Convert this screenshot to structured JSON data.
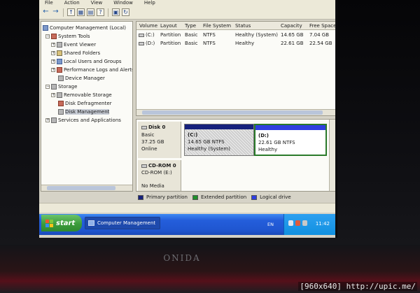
{
  "menu": [
    "File",
    "Action",
    "View",
    "Window",
    "Help"
  ],
  "toolbar": {
    "icons": [
      "back-arrow-icon",
      "forward-arrow-icon",
      "up-icon",
      "console-tree-icon",
      "properties-icon",
      "help-icon",
      "export-icon",
      "refresh-icon"
    ]
  },
  "tree": {
    "items": [
      {
        "label": "Computer Management (Local)",
        "indent": 0,
        "expander": "",
        "icon": "computer-icon"
      },
      {
        "label": "System Tools",
        "indent": 1,
        "expander": "−",
        "icon": "tools-icon"
      },
      {
        "label": "Event Viewer",
        "indent": 2,
        "expander": "+",
        "icon": "event-viewer-icon"
      },
      {
        "label": "Shared Folders",
        "indent": 2,
        "expander": "+",
        "icon": "shared-folder-icon"
      },
      {
        "label": "Local Users and Groups",
        "indent": 2,
        "expander": "+",
        "icon": "users-icon"
      },
      {
        "label": "Performance Logs and Alerts",
        "indent": 2,
        "expander": "+",
        "icon": "performance-icon"
      },
      {
        "label": "Device Manager",
        "indent": 2,
        "expander": "",
        "icon": "device-manager-icon"
      },
      {
        "label": "Storage",
        "indent": 1,
        "expander": "−",
        "icon": "storage-icon"
      },
      {
        "label": "Removable Storage",
        "indent": 2,
        "expander": "+",
        "icon": "removable-storage-icon"
      },
      {
        "label": "Disk Defragmenter",
        "indent": 2,
        "expander": "",
        "icon": "defragmenter-icon"
      },
      {
        "label": "Disk Management",
        "indent": 2,
        "expander": "",
        "icon": "disk-management-icon",
        "selected": true
      },
      {
        "label": "Services and Applications",
        "indent": 1,
        "expander": "+",
        "icon": "services-icon"
      }
    ]
  },
  "volumes": {
    "headers": [
      "Volume",
      "Layout",
      "Type",
      "File System",
      "Status",
      "Capacity",
      "Free Space"
    ],
    "rows": [
      {
        "volume": "(C:)",
        "layout": "Partition",
        "type": "Basic",
        "fs": "NTFS",
        "status": "Healthy (System)",
        "capacity": "14.65 GB",
        "free": "7.04 GB",
        "selected": true
      },
      {
        "volume": "(D:)",
        "layout": "Partition",
        "type": "Basic",
        "fs": "NTFS",
        "status": "Healthy",
        "capacity": "22.61 GB",
        "free": "22.54 GB"
      }
    ]
  },
  "disks": {
    "disk0": {
      "name": "Disk 0",
      "type": "Basic",
      "size": "37.25 GB",
      "state": "Online",
      "partitions": [
        {
          "name": "(C:)",
          "size_fs": "14.65 GB NTFS",
          "status": "Healthy (System)"
        },
        {
          "name": "(D:)",
          "size_fs": "22.61 GB NTFS",
          "status": "Healthy"
        }
      ]
    },
    "cdrom0": {
      "name": "CD-ROM 0",
      "drive": "CD-ROM (E:)",
      "media": "No Media"
    }
  },
  "legend": [
    {
      "label": "Primary partition",
      "color": "#16217c"
    },
    {
      "label": "Extended partition",
      "color": "#1f8f2a"
    },
    {
      "label": "Logical drive",
      "color": "#2f3fe0"
    }
  ],
  "taskbar": {
    "start_label": "start",
    "task_label": "Computer Management",
    "language": "EN",
    "clock": "11:42"
  },
  "monitor": {
    "brand": "ONIDA"
  },
  "watermark": "[960x640] http://upic.me/"
}
